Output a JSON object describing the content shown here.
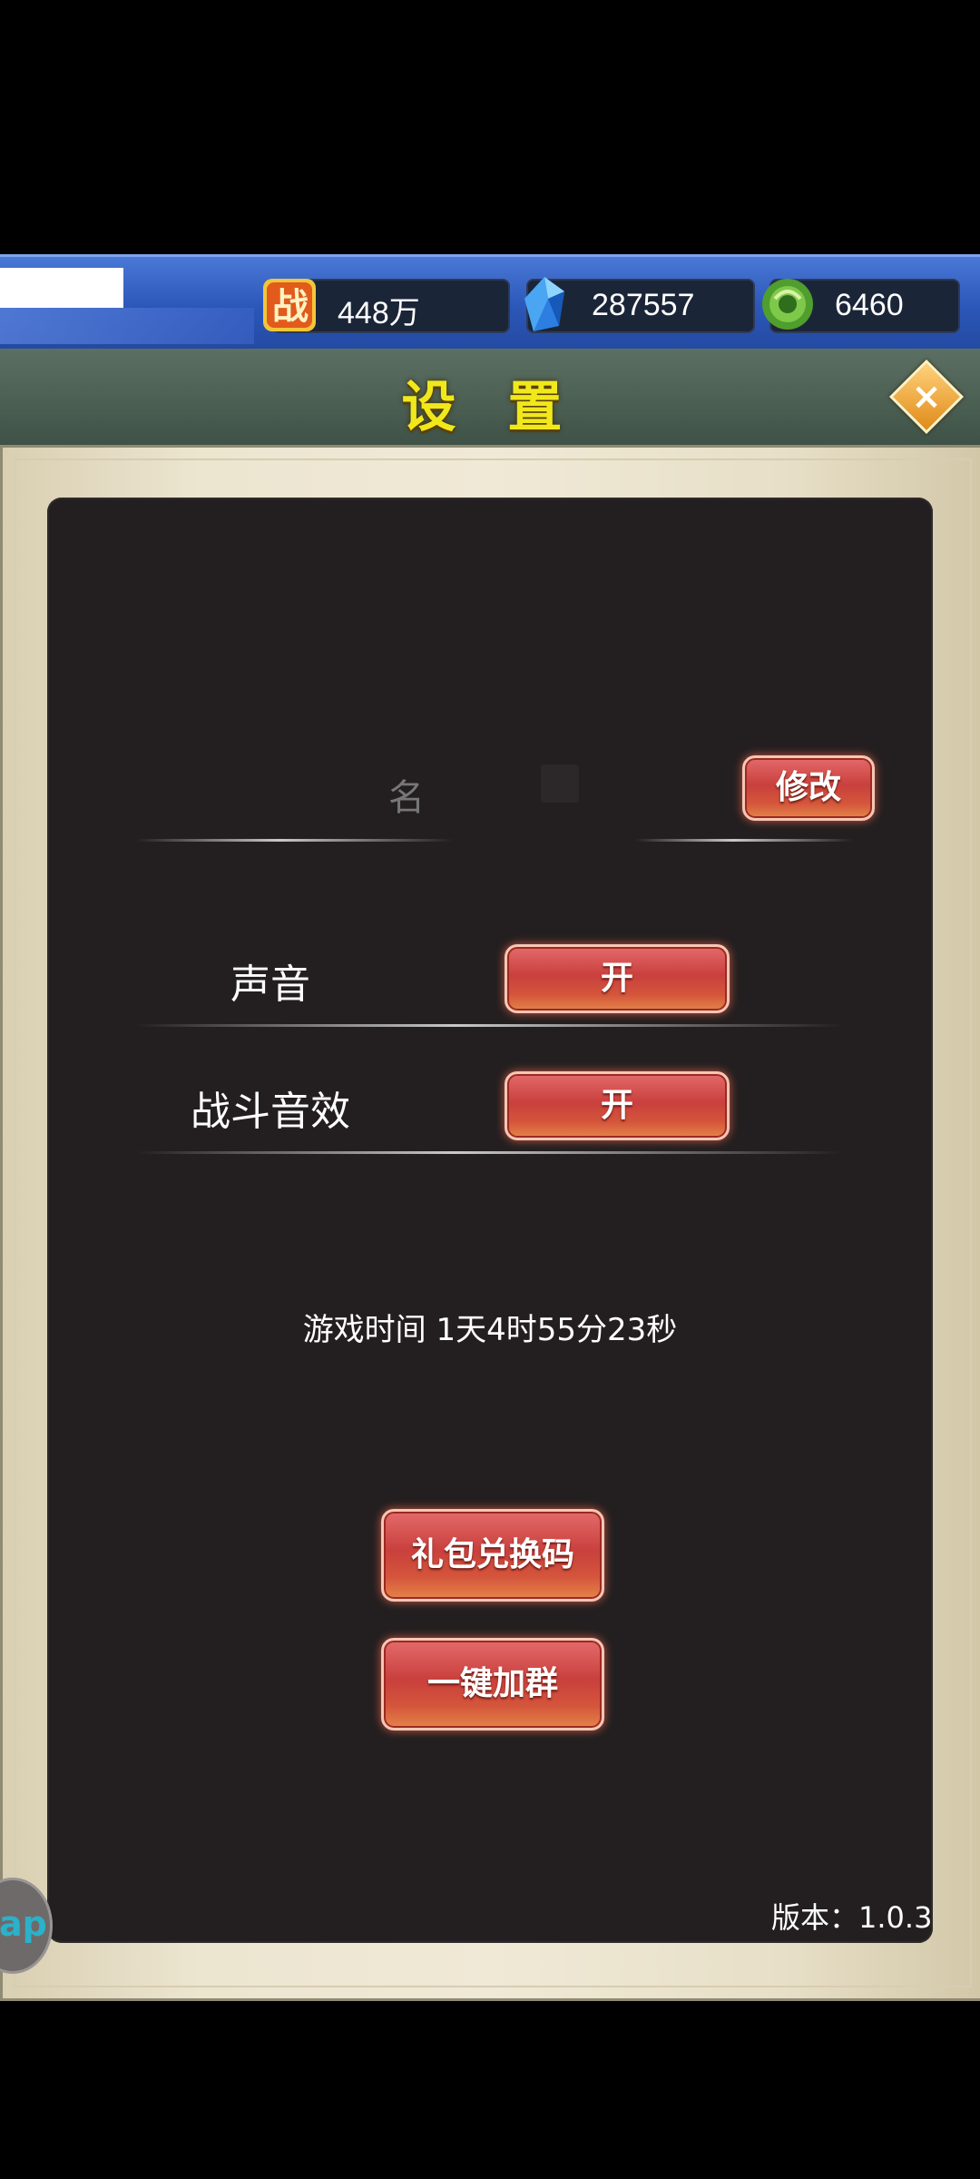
{
  "resources": [
    {
      "icon": "battle-power-icon",
      "glyph": "战",
      "value": "448万"
    },
    {
      "icon": "crystal-icon",
      "value": "287557"
    },
    {
      "icon": "jade-coin-icon",
      "value": "6460"
    }
  ],
  "header": {
    "title": "设 置",
    "close_icon": "close-icon"
  },
  "name_row": {
    "edit_label": "修改"
  },
  "settings": [
    {
      "label": "声音",
      "toggle": "开"
    },
    {
      "label": "战斗音效",
      "toggle": "开"
    }
  ],
  "playtime": "游戏时间 1天4时55分23秒",
  "buttons": {
    "gift_code": "礼包兑换码",
    "join_group": "一键加群"
  },
  "version": "版本：1.0.3",
  "float_button": {
    "text": "ap"
  },
  "colors": {
    "title": "#f1e81c",
    "button": "#c9403d",
    "panel": "#231f20",
    "header": "#4a5e52"
  }
}
